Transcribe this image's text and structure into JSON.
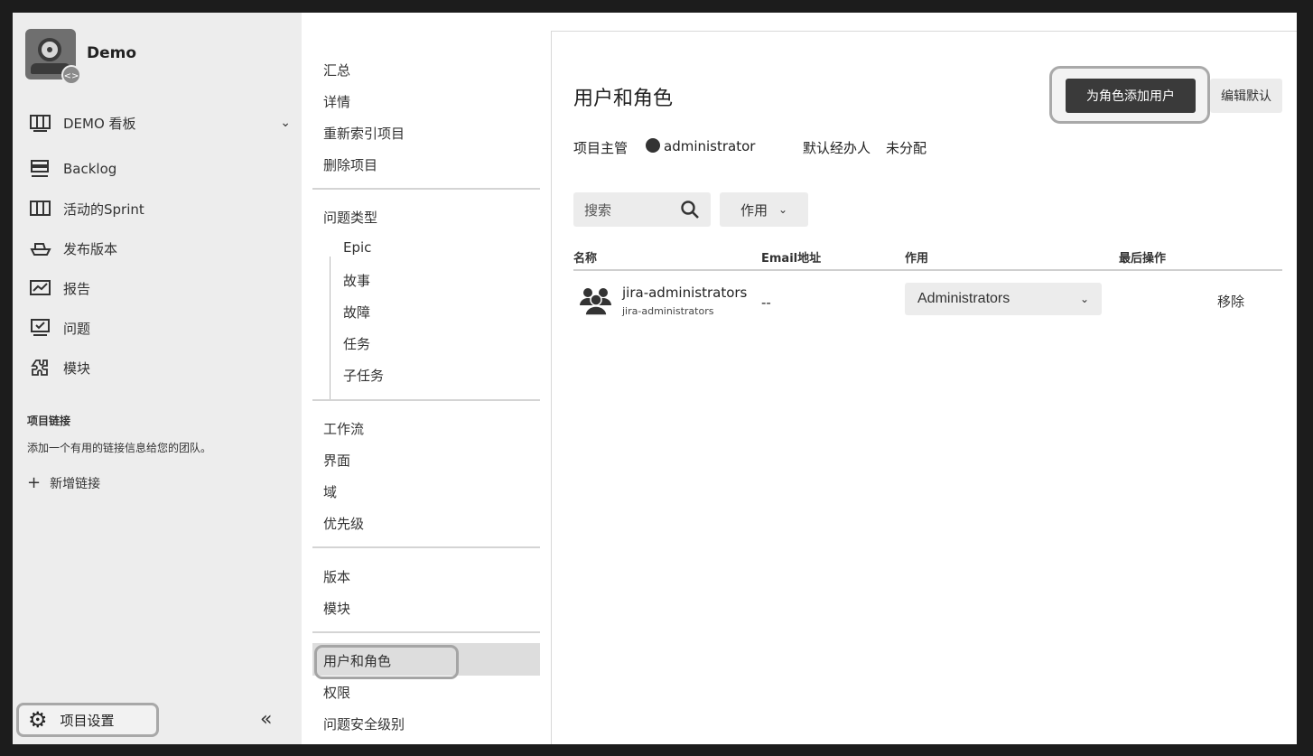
{
  "project": {
    "name": "Demo",
    "badge_glyph": "<>"
  },
  "sidebar": {
    "items": [
      {
        "label": "DEMO 看板",
        "icon": "board-icon",
        "has_chevron": true,
        "chevron": "⌄"
      },
      {
        "label": "Backlog",
        "icon": "backlog-icon"
      },
      {
        "label": "活动的Sprint",
        "icon": "sprint-icon"
      },
      {
        "label": "发布版本",
        "icon": "ship-icon"
      },
      {
        "label": "报告",
        "icon": "report-icon"
      },
      {
        "label": "问题",
        "icon": "issues-icon"
      },
      {
        "label": "模块",
        "icon": "component-icon"
      }
    ],
    "project_links_title": "项目链接",
    "project_links_desc": "添加一个有用的链接信息给您的团队。",
    "add_link_label": "新增链接",
    "settings_label": "项目设置",
    "collapse_glyph": "«"
  },
  "submenu": {
    "group1": [
      "汇总",
      "详情",
      "重新索引项目",
      "删除项目"
    ],
    "issue_types_label": "问题类型",
    "issue_types": [
      "Epic",
      "故事",
      "故障",
      "任务",
      "子任务"
    ],
    "group3": [
      "工作流",
      "界面",
      "域",
      "优先级"
    ],
    "group4": [
      "版本",
      "模块"
    ],
    "group5": [
      "用户和角色",
      "权限",
      "问题安全级别"
    ],
    "active": "用户和角色"
  },
  "main": {
    "title": "用户和角色",
    "add_user_button": "为角色添加用户",
    "edit_default_button": "编辑默认",
    "project_lead_label": "项目主管",
    "project_lead_value": "administrator",
    "default_assignee_label": "默认经办人",
    "default_assignee_value": "未分配",
    "search_placeholder": "搜索",
    "role_filter_label": "作用",
    "columns": [
      "名称",
      "Email地址",
      "作用",
      "最后操作"
    ],
    "rows": [
      {
        "name": "jira-administrators",
        "subname": "jira-administrators",
        "email": "--",
        "role": "Administrators",
        "action": "移除"
      }
    ]
  }
}
